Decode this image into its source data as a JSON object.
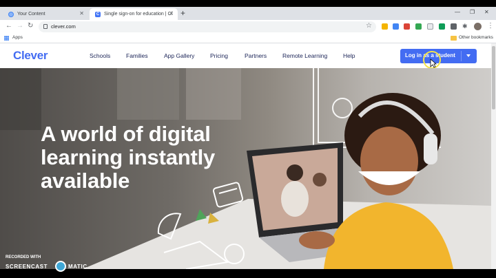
{
  "browser": {
    "tabs": [
      {
        "title": "Your Content"
      },
      {
        "title": "Single sign-on for education | Cl"
      }
    ],
    "url": "clever.com",
    "bookmarks": {
      "apps_label": "Apps",
      "other_label": "Other bookmarks"
    }
  },
  "site": {
    "logo": "Clever",
    "nav": [
      "Schools",
      "Families",
      "App Gallery",
      "Pricing",
      "Partners",
      "Remote Learning",
      "Help"
    ],
    "login_label": "Log in as a student",
    "accent": "#436cf2"
  },
  "hero": {
    "headline_lines": [
      "A world of digital",
      "learning instantly",
      "available"
    ]
  },
  "watermark": {
    "line1": "RECORDED WITH",
    "line2": "SCREENCAST",
    "line3": "MATIC"
  }
}
